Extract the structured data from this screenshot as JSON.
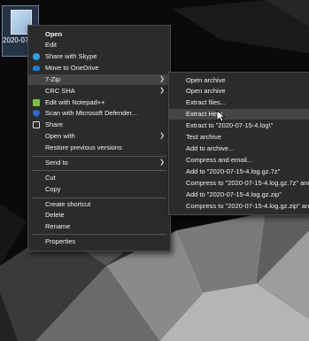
{
  "desktop": {
    "file_label": "2020-07-15-4.log"
  },
  "context_menu": {
    "items": [
      {
        "label": "Open"
      },
      {
        "label": "Edit"
      },
      {
        "label": "Share with Skype",
        "icon": "skype-icon"
      },
      {
        "label": "Move to OneDrive",
        "icon": "onedrive-icon"
      },
      {
        "label": "7-Zip",
        "submenu": true
      },
      {
        "label": "CRC SHA",
        "submenu": true
      },
      {
        "label": "Edit with Notepad++",
        "icon": "notepad-plus-plus-icon"
      },
      {
        "label": "Scan with Microsoft Defender...",
        "icon": "defender-icon"
      },
      {
        "label": "Share",
        "icon": "share-icon"
      },
      {
        "label": "Open with",
        "submenu": true
      },
      {
        "label": "Restore previous versions"
      },
      {
        "label": "Send to",
        "submenu": true
      },
      {
        "label": "Cut"
      },
      {
        "label": "Copy"
      },
      {
        "label": "Create shortcut"
      },
      {
        "label": "Delete"
      },
      {
        "label": "Rename"
      },
      {
        "label": "Properties"
      }
    ]
  },
  "zip_submenu": {
    "items": [
      {
        "label": "Open archive"
      },
      {
        "label": "Open archive"
      },
      {
        "label": "Extract files..."
      },
      {
        "label": "Extract Here"
      },
      {
        "label": "Extract to \"2020-07-15-4.log\\\""
      },
      {
        "label": "Test archive"
      },
      {
        "label": "Add to archive..."
      },
      {
        "label": "Compress and email..."
      },
      {
        "label": "Add to \"2020-07-15-4.log.gz.7z\""
      },
      {
        "label": "Compress to \"2020-07-15-4.log.gz.7z\" and em"
      },
      {
        "label": "Add to \"2020-07-15-4.log.gz.zip\""
      },
      {
        "label": "Compress to \"2020-07-15-4.log.gz.zip\" and em"
      }
    ]
  },
  "colors": {
    "menu_bg": "#2b2b2b",
    "highlight": "#454545",
    "text": "#f2f2f2"
  }
}
